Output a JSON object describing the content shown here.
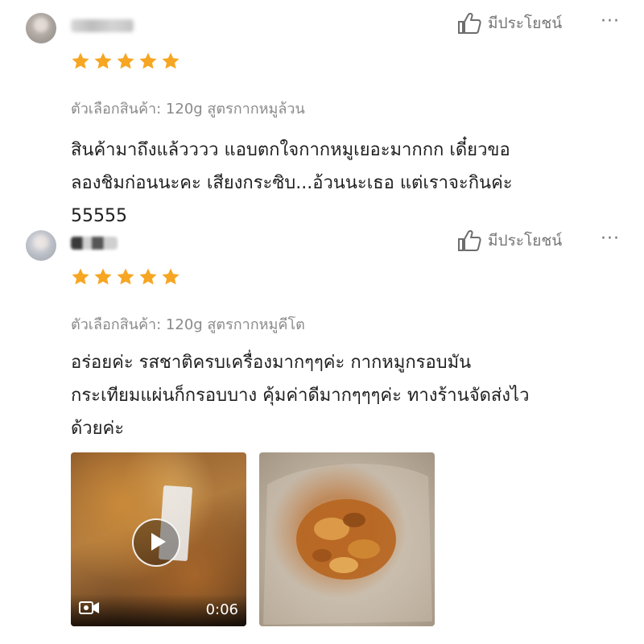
{
  "reviews": [
    {
      "rating": 5,
      "helpful_label": "มีประโยชน์",
      "more_label": "···",
      "variant": "ตัวเลือกสินค้า: 120g สูตรกากหมูล้วน",
      "text_lines": [
        "สินค้ามาถึงแล้วววว แอบตกใจกากหมูเยอะมากกก เดี๋ยวขอ",
        "ลองชิมก่อนนะคะ เสียงกระซิบ...อ้วนนะเธอ แต่เราจะกินค่ะ",
        "55555"
      ]
    },
    {
      "rating": 5,
      "helpful_label": "มีประโยชน์",
      "more_label": "···",
      "variant": "ตัวเลือกสินค้า: 120g สูตรกากหมูคีโต",
      "text_lines": [
        "อร่อยค่ะ  รสชาติครบเครื่องมากๆๆค่ะ กากหมูกรอบมัน",
        "กระเทียมแผ่นก็กรอบบาง คุ้มค่าดีมากๆๆๆค่ะ ทางร้านจัดส่งไว",
        "ด้วยค่ะ"
      ],
      "media": {
        "video_duration": "0:06"
      }
    }
  ],
  "colors": {
    "star": "#F6A623",
    "muted_text": "#757575",
    "body_text": "#1f1f1f"
  },
  "icons": {
    "helpful": "thumbs-up-icon",
    "more": "more-dots-icon",
    "star": "star-icon",
    "play": "play-icon",
    "camera": "video-camera-icon"
  }
}
